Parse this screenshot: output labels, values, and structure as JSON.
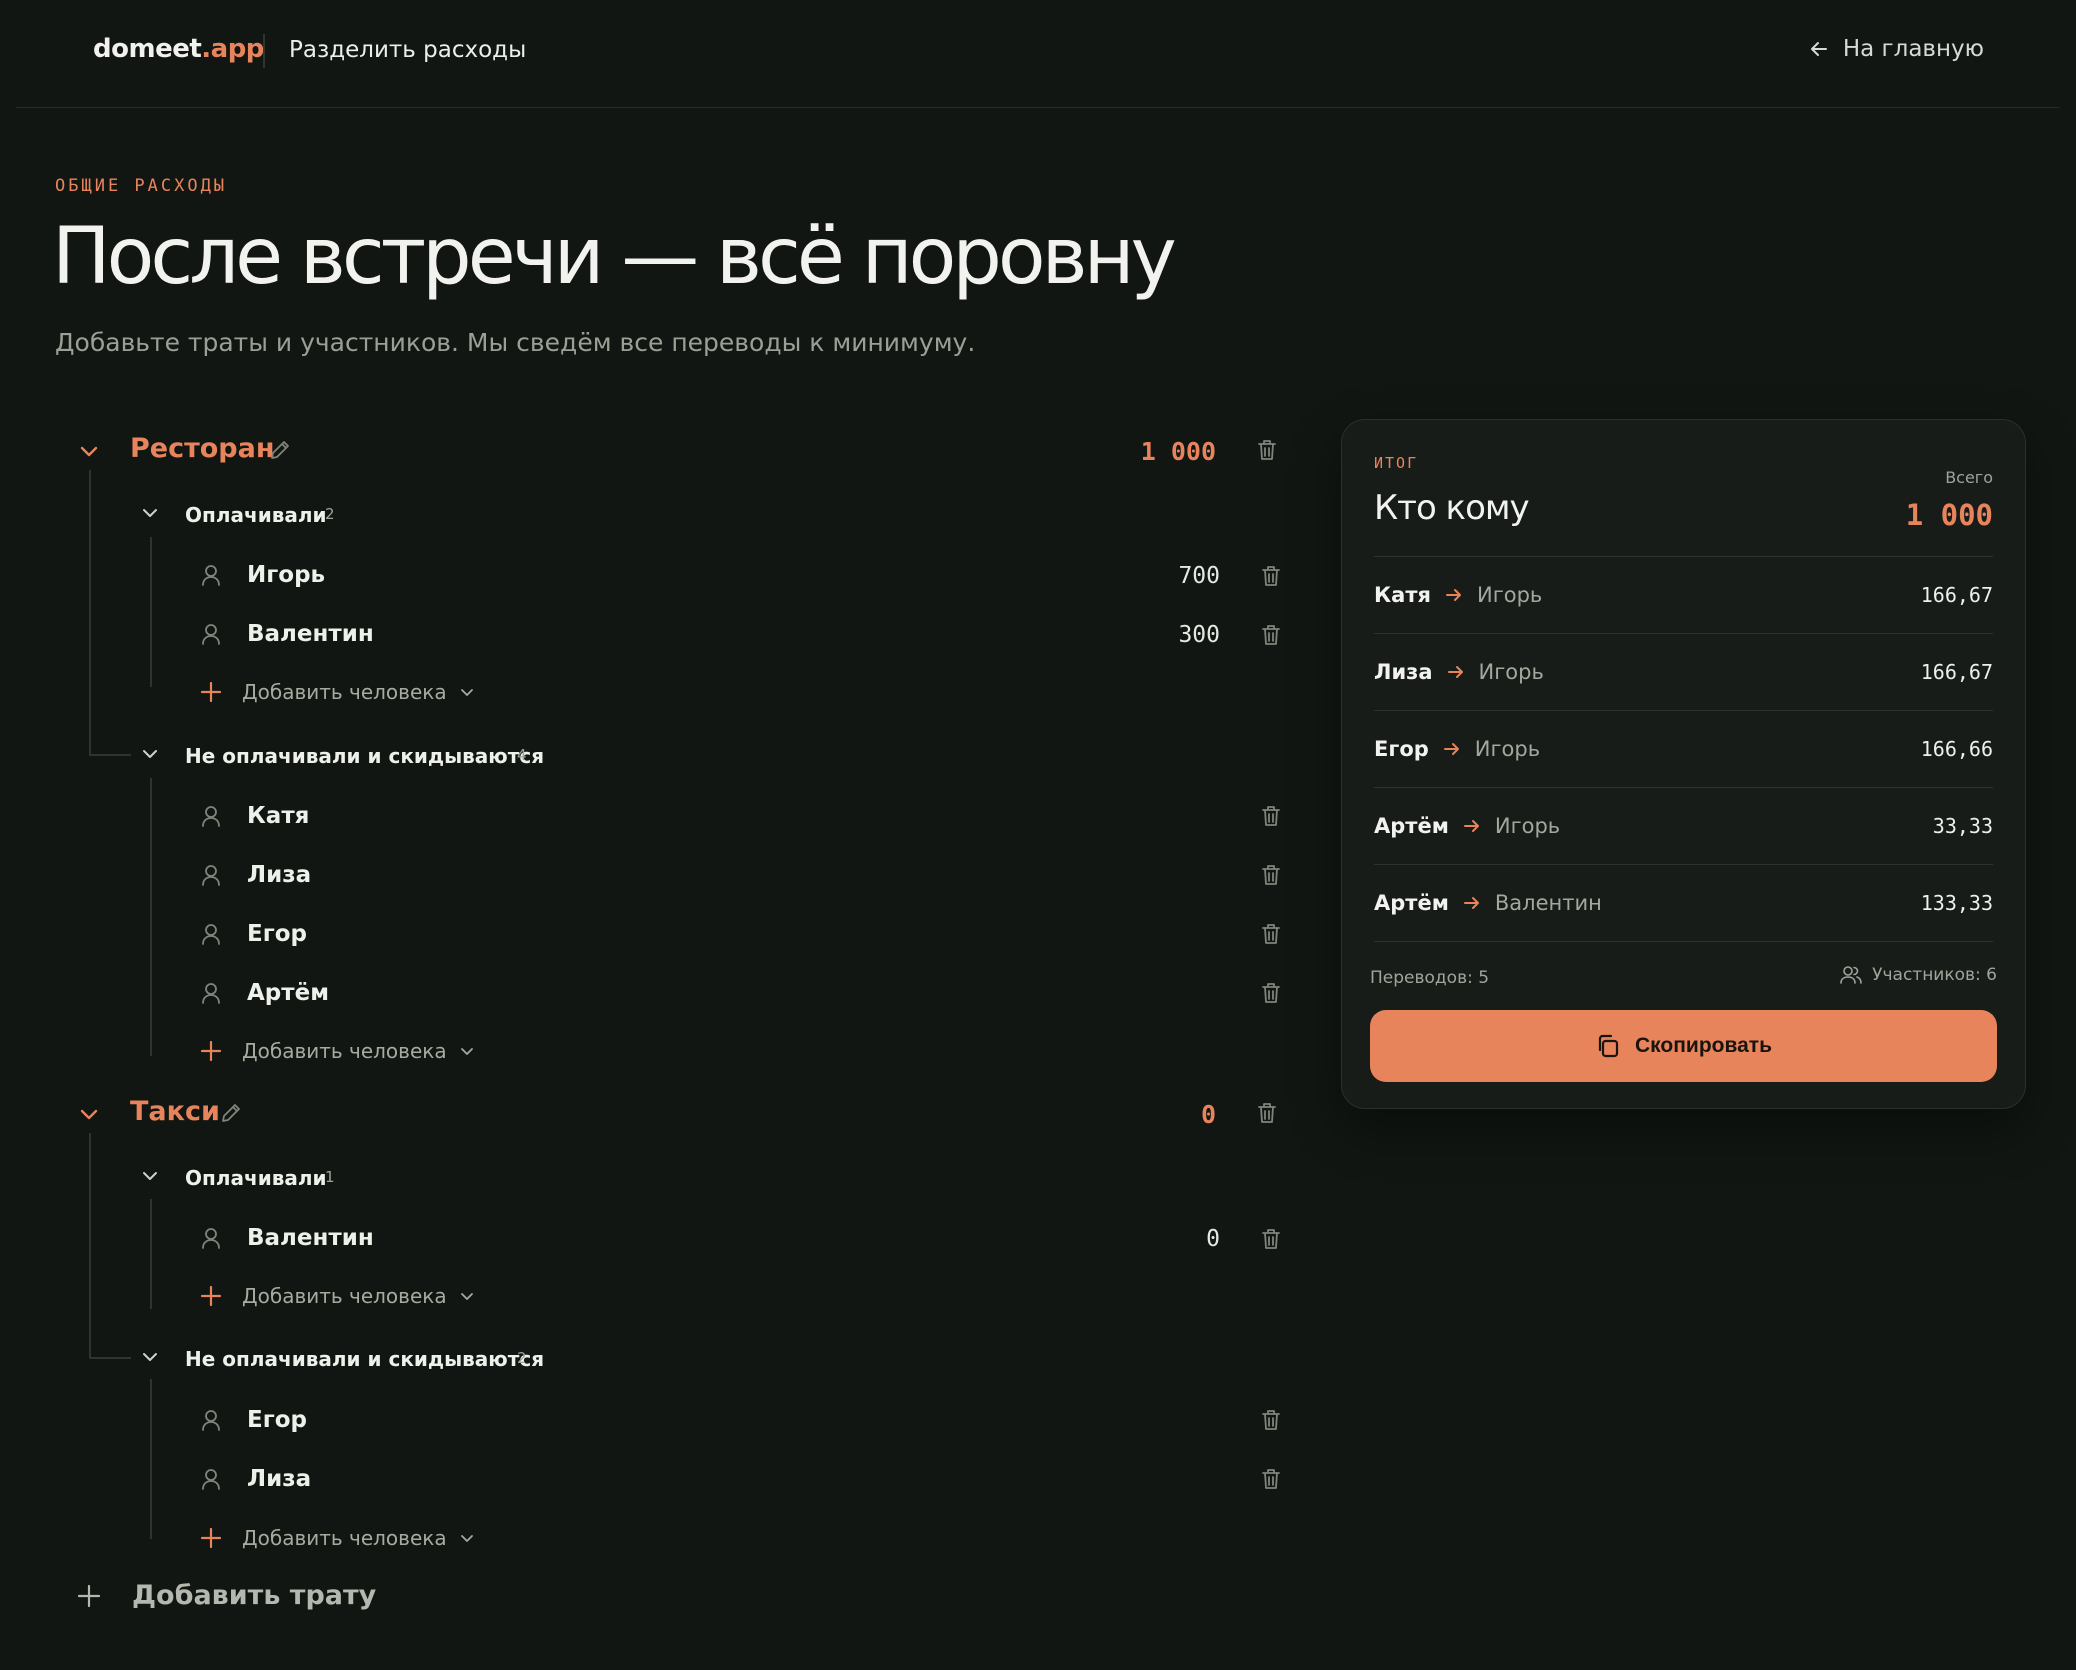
{
  "header": {
    "logo_main": "domeet",
    "logo_accent": ".app",
    "title": "Разделить расходы",
    "back_label": "На главную"
  },
  "intro": {
    "eyebrow": "ОБЩИЕ РАСХОДЫ",
    "title": "После встречи — всё поровну",
    "subtitle": "Добавьте траты и участников. Мы сведём все переводы к минимуму."
  },
  "expenses": [
    {
      "name": "Ресторан",
      "total": "1 000",
      "payers_label": "Оплачивали",
      "payers_count": "2",
      "payers": [
        {
          "name": "Игорь",
          "amount": "700"
        },
        {
          "name": "Валентин",
          "amount": "300"
        }
      ],
      "sharers_label": "Не оплачивали и скидываются",
      "sharers_count": "4",
      "sharers": [
        {
          "name": "Катя"
        },
        {
          "name": "Лиза"
        },
        {
          "name": "Егор"
        },
        {
          "name": "Артём"
        }
      ]
    },
    {
      "name": "Такси",
      "total": "0",
      "payers_label": "Оплачивали",
      "payers_count": "1",
      "payers": [
        {
          "name": "Валентин",
          "amount": "0"
        }
      ],
      "sharers_label": "Не оплачивали и скидываются",
      "sharers_count": "2",
      "sharers": [
        {
          "name": "Егор"
        },
        {
          "name": "Лиза"
        }
      ]
    }
  ],
  "add_person_label": "Добавить человека",
  "add_expense_label": "Добавить трату",
  "summary": {
    "eyebrow": "ИТОГ",
    "title": "Кто кому",
    "total_label": "Всего",
    "total": "1 000",
    "transfers": [
      {
        "from": "Катя",
        "to": "Игорь",
        "amount": "166,67"
      },
      {
        "from": "Лиза",
        "to": "Игорь",
        "amount": "166,67"
      },
      {
        "from": "Егор",
        "to": "Игорь",
        "amount": "166,66"
      },
      {
        "from": "Артём",
        "to": "Игорь",
        "amount": "33,33"
      },
      {
        "from": "Артём",
        "to": "Валентин",
        "amount": "133,33"
      }
    ],
    "transfers_count_label": "Переводов: 5",
    "participants_count_label": "Участников: 6",
    "copy_label": "Скопировать"
  },
  "colors": {
    "background": "#111612",
    "accent": "#e8845c",
    "card": "#171c18"
  },
  "icons": [
    "arrow-left-icon",
    "chevron-down-icon",
    "pencil-icon",
    "trash-icon",
    "user-icon",
    "plus-icon",
    "arrow-right-icon",
    "users-icon",
    "copy-icon"
  ]
}
